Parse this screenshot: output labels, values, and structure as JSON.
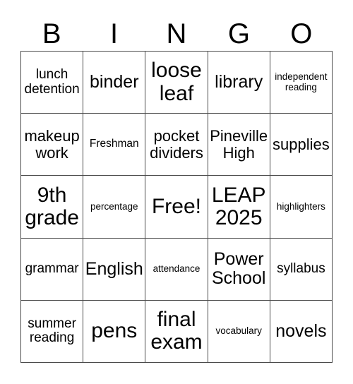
{
  "header": {
    "letters": [
      "B",
      "I",
      "N",
      "G",
      "O"
    ]
  },
  "cells": [
    [
      "lunch\ndetention",
      "binder",
      "loose\nleaf",
      "library",
      "independent\nreading"
    ],
    [
      "makeup\nwork",
      "Freshman",
      "pocket\ndividers",
      "Pineville\nHigh",
      "supplies"
    ],
    [
      "9th\ngrade",
      "percentage",
      "Free!",
      "LEAP\n2025",
      "highlighters"
    ],
    [
      "grammar",
      "English",
      "attendance",
      "Power\nSchool",
      "syllabus"
    ],
    [
      "summer\nreading",
      "pens",
      "final\nexam",
      "vocabulary",
      "novels"
    ]
  ]
}
